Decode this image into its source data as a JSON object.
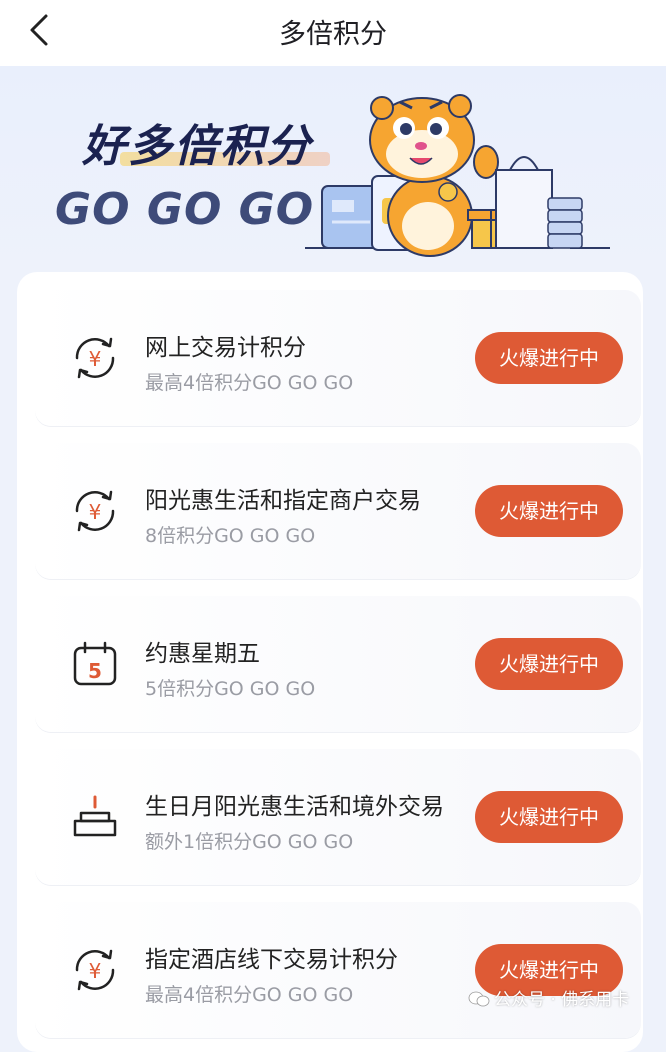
{
  "nav": {
    "title": "多倍积分"
  },
  "hero": {
    "title": "好多倍积分",
    "subtitle": "GO GO GO"
  },
  "accent_color": "#de5a35",
  "items": [
    {
      "name": "网上交易计积分",
      "sub": "最高4倍积分GO GO GO",
      "button": "火爆进行中",
      "icon": "yuan-cycle-icon"
    },
    {
      "name": "阳光惠生活和指定商户交易",
      "sub": "8倍积分GO GO GO",
      "button": "火爆进行中",
      "icon": "yuan-cycle-icon"
    },
    {
      "name": "约惠星期五",
      "sub": "5倍积分GO GO GO",
      "button": "火爆进行中",
      "icon": "calendar-five-icon"
    },
    {
      "name": "生日月阳光惠生活和境外交易",
      "sub": "额外1倍积分GO GO GO",
      "button": "火爆进行中",
      "icon": "birthday-cake-icon"
    },
    {
      "name": "指定酒店线下交易计积分",
      "sub": "最高4倍积分GO GO GO",
      "button": "火爆进行中",
      "icon": "yuan-cycle-icon"
    }
  ],
  "watermark": "公众号 · 佛系用卡"
}
